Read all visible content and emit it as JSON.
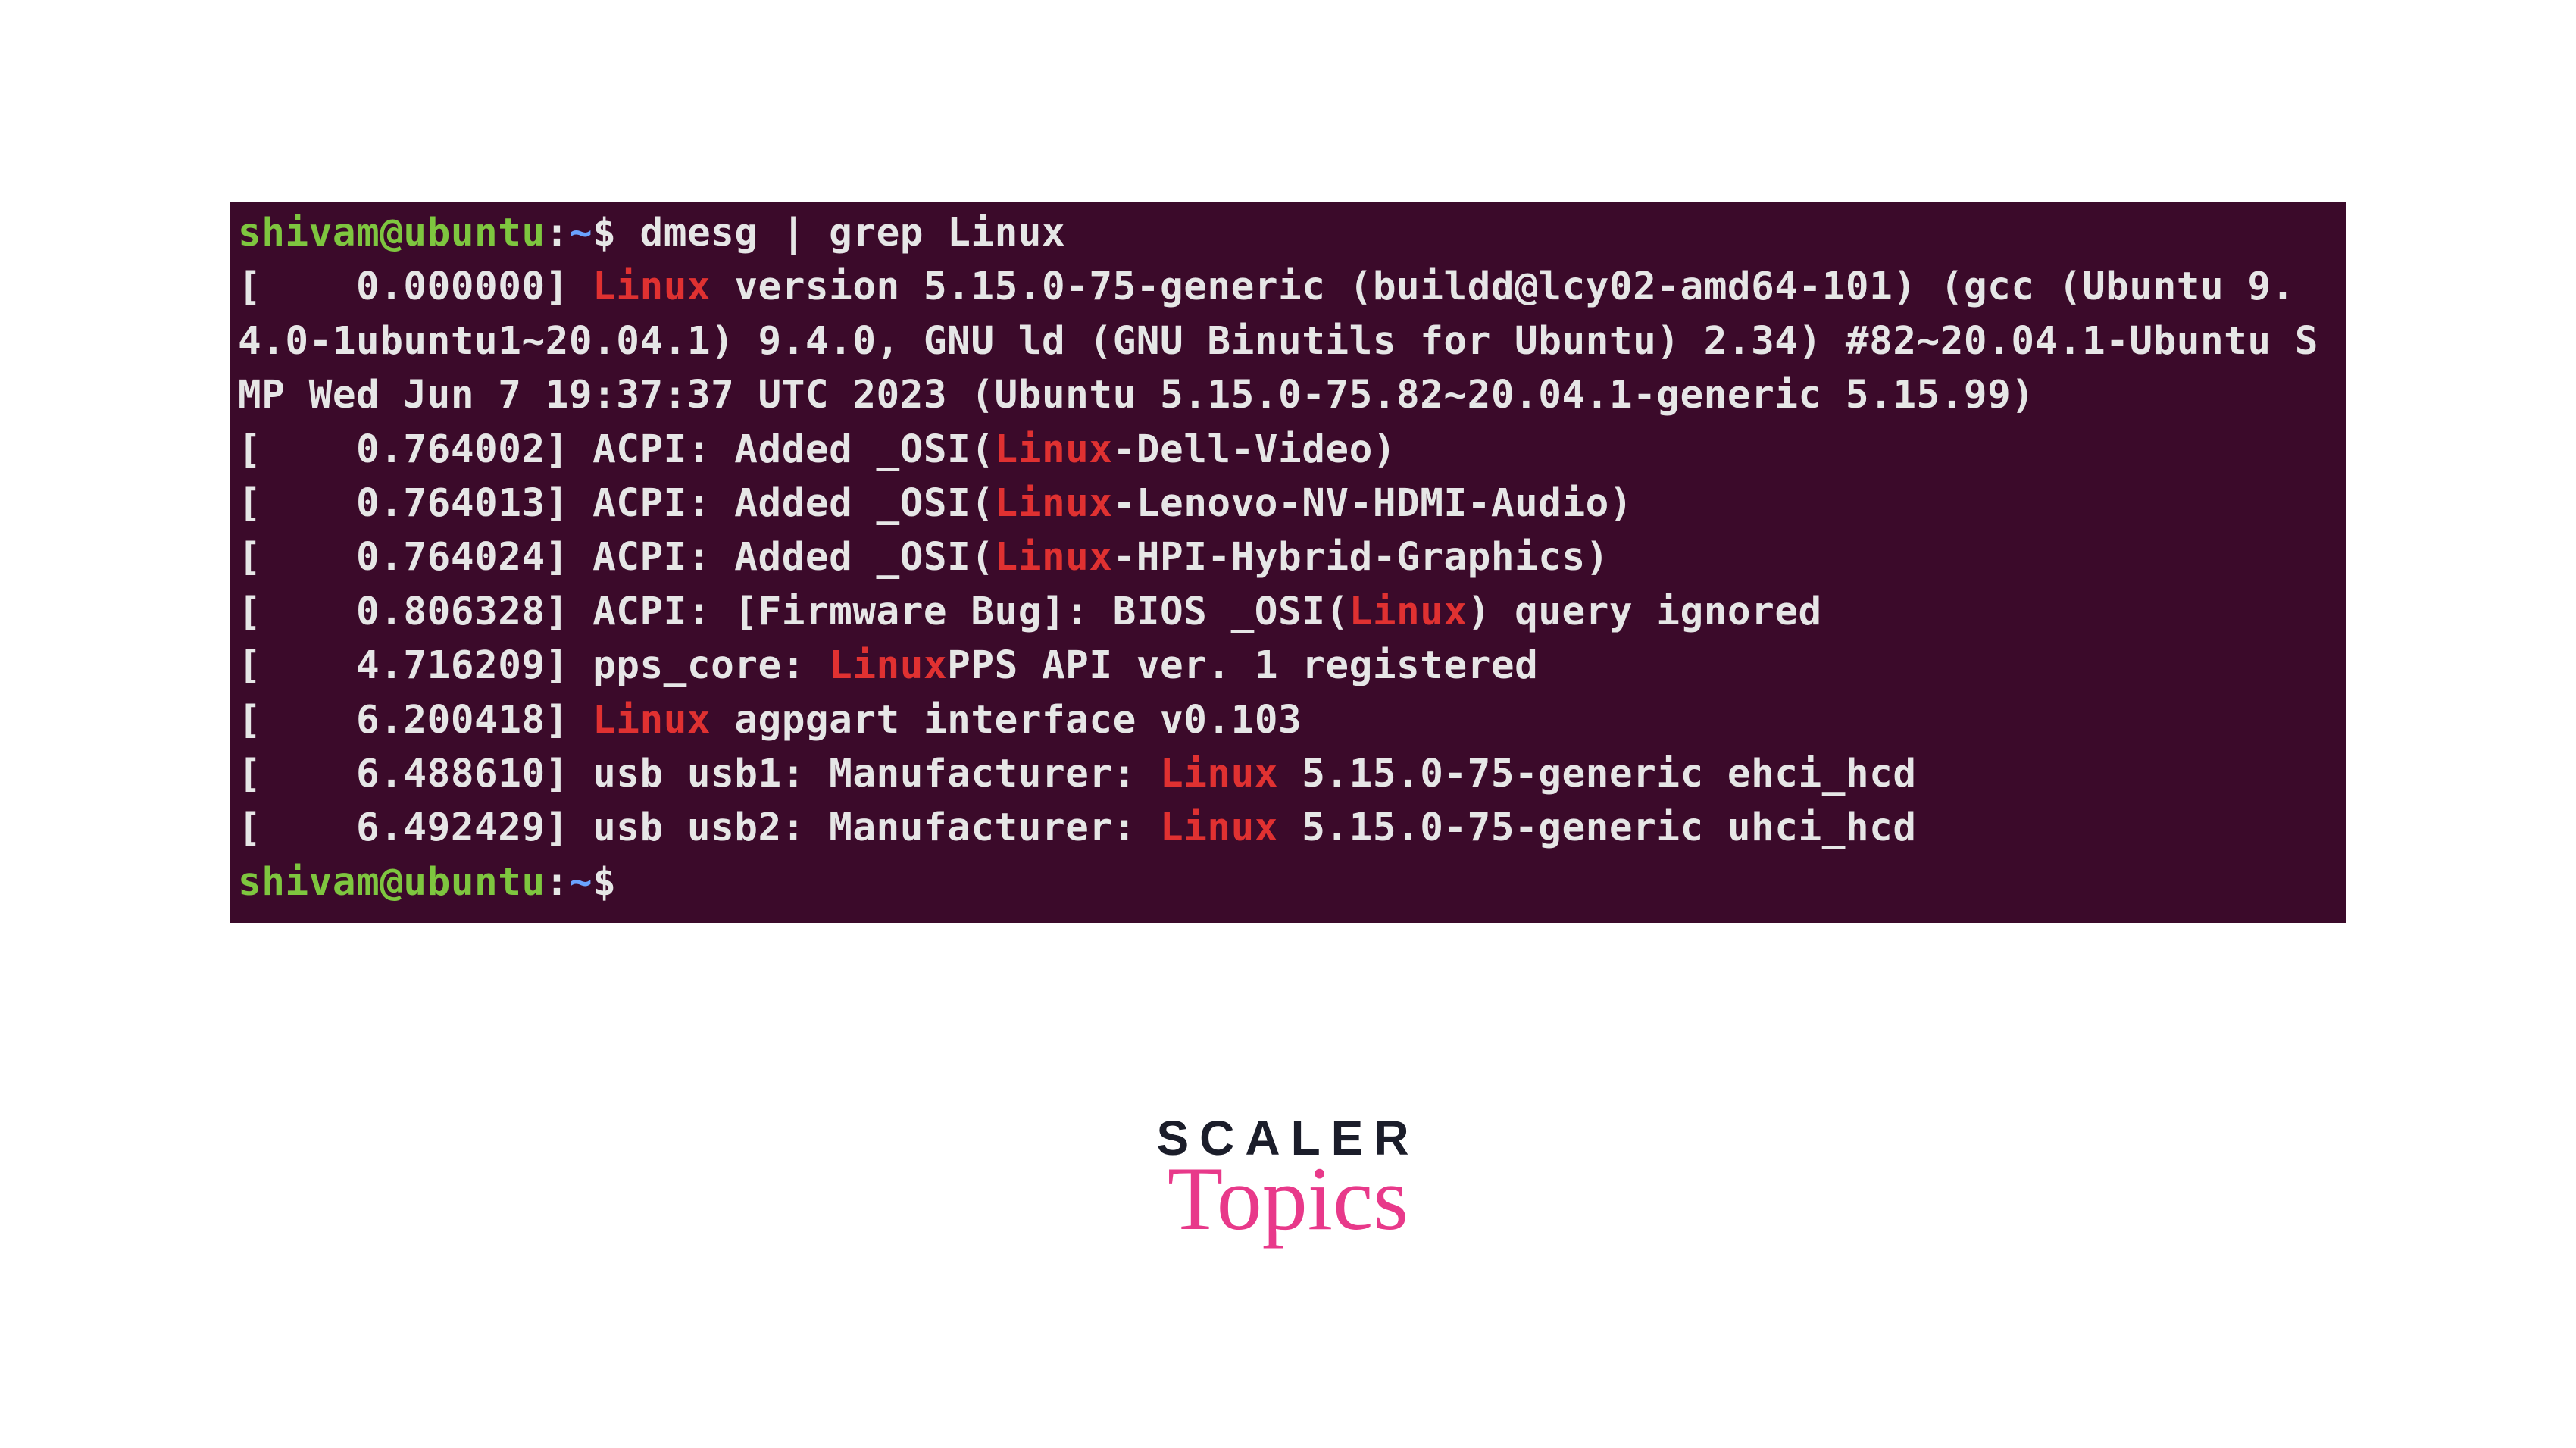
{
  "prompt": {
    "user": "shivam@ubuntu",
    "colon": ":",
    "path": "~",
    "dollar": "$ "
  },
  "command": "dmesg | grep Linux",
  "match_word": "Linux",
  "lines": [
    {
      "segs": [
        {
          "t": "out",
          "v": "[    0.000000] "
        },
        {
          "t": "match",
          "v": "Linux"
        },
        {
          "t": "out",
          "v": " version 5.15.0-75-generic (buildd@lcy02-amd64-101) (gcc (Ubuntu 9.4.0-1ubuntu1~20.04.1) 9.4.0, GNU ld (GNU Binutils for Ubuntu) 2.34) #82~20.04.1-Ubuntu SMP Wed Jun 7 19:37:37 UTC 2023 (Ubuntu 5.15.0-75.82~20.04.1-generic 5.15.99)"
        }
      ]
    },
    {
      "segs": [
        {
          "t": "out",
          "v": "[    0.764002] ACPI: Added _OSI("
        },
        {
          "t": "match",
          "v": "Linux"
        },
        {
          "t": "out",
          "v": "-Dell-Video)"
        }
      ]
    },
    {
      "segs": [
        {
          "t": "out",
          "v": "[    0.764013] ACPI: Added _OSI("
        },
        {
          "t": "match",
          "v": "Linux"
        },
        {
          "t": "out",
          "v": "-Lenovo-NV-HDMI-Audio)"
        }
      ]
    },
    {
      "segs": [
        {
          "t": "out",
          "v": "[    0.764024] ACPI: Added _OSI("
        },
        {
          "t": "match",
          "v": "Linux"
        },
        {
          "t": "out",
          "v": "-HPI-Hybrid-Graphics)"
        }
      ]
    },
    {
      "segs": [
        {
          "t": "out",
          "v": "[    0.806328] ACPI: [Firmware Bug]: BIOS _OSI("
        },
        {
          "t": "match",
          "v": "Linux"
        },
        {
          "t": "out",
          "v": ") query ignored"
        }
      ]
    },
    {
      "segs": [
        {
          "t": "out",
          "v": "[    4.716209] pps_core: "
        },
        {
          "t": "match",
          "v": "Linux"
        },
        {
          "t": "out",
          "v": "PPS API ver. 1 registered"
        }
      ]
    },
    {
      "segs": [
        {
          "t": "out",
          "v": "[    6.200418] "
        },
        {
          "t": "match",
          "v": "Linux"
        },
        {
          "t": "out",
          "v": " agpgart interface v0.103"
        }
      ]
    },
    {
      "segs": [
        {
          "t": "out",
          "v": "[    6.488610] usb usb1: Manufacturer: "
        },
        {
          "t": "match",
          "v": "Linux"
        },
        {
          "t": "out",
          "v": " 5.15.0-75-generic ehci_hcd"
        }
      ]
    },
    {
      "segs": [
        {
          "t": "out",
          "v": "[    6.492429] usb usb2: Manufacturer: "
        },
        {
          "t": "match",
          "v": "Linux"
        },
        {
          "t": "out",
          "v": " 5.15.0-75-generic uhci_hcd"
        }
      ]
    }
  ],
  "logo": {
    "top": "SCALER",
    "bottom": "Topics"
  }
}
